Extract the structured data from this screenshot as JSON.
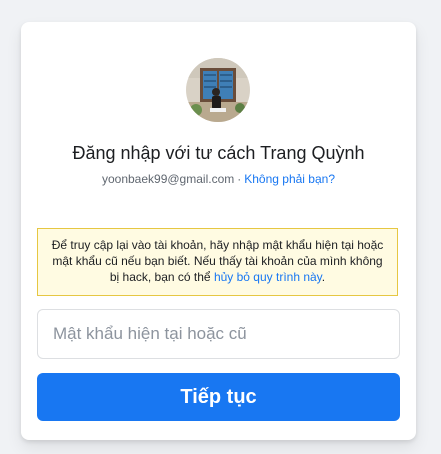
{
  "profile": {
    "title": "Đăng nhập với tư cách Trang Quỳnh",
    "email": "yoonbaek99@gmail.com",
    "separator": "·",
    "not_you_link": "Không phải bạn?"
  },
  "notice": {
    "text": "Để truy cập lại vào tài khoản, hãy nhập mật khẩu hiện tại hoặc mật khẩu cũ nếu bạn biết. Nếu thấy tài khoản của mình không bị hack, bạn có thể ",
    "cancel_link": "hủy bỏ quy trình này",
    "end": "."
  },
  "password": {
    "placeholder": "Mật khẩu hiện tại hoặc cũ",
    "value": ""
  },
  "continue_button": {
    "label": "Tiếp tục"
  },
  "colors": {
    "accent": "#1877f2",
    "notice_bg": "#fffbe2",
    "notice_border": "#e6c742"
  }
}
